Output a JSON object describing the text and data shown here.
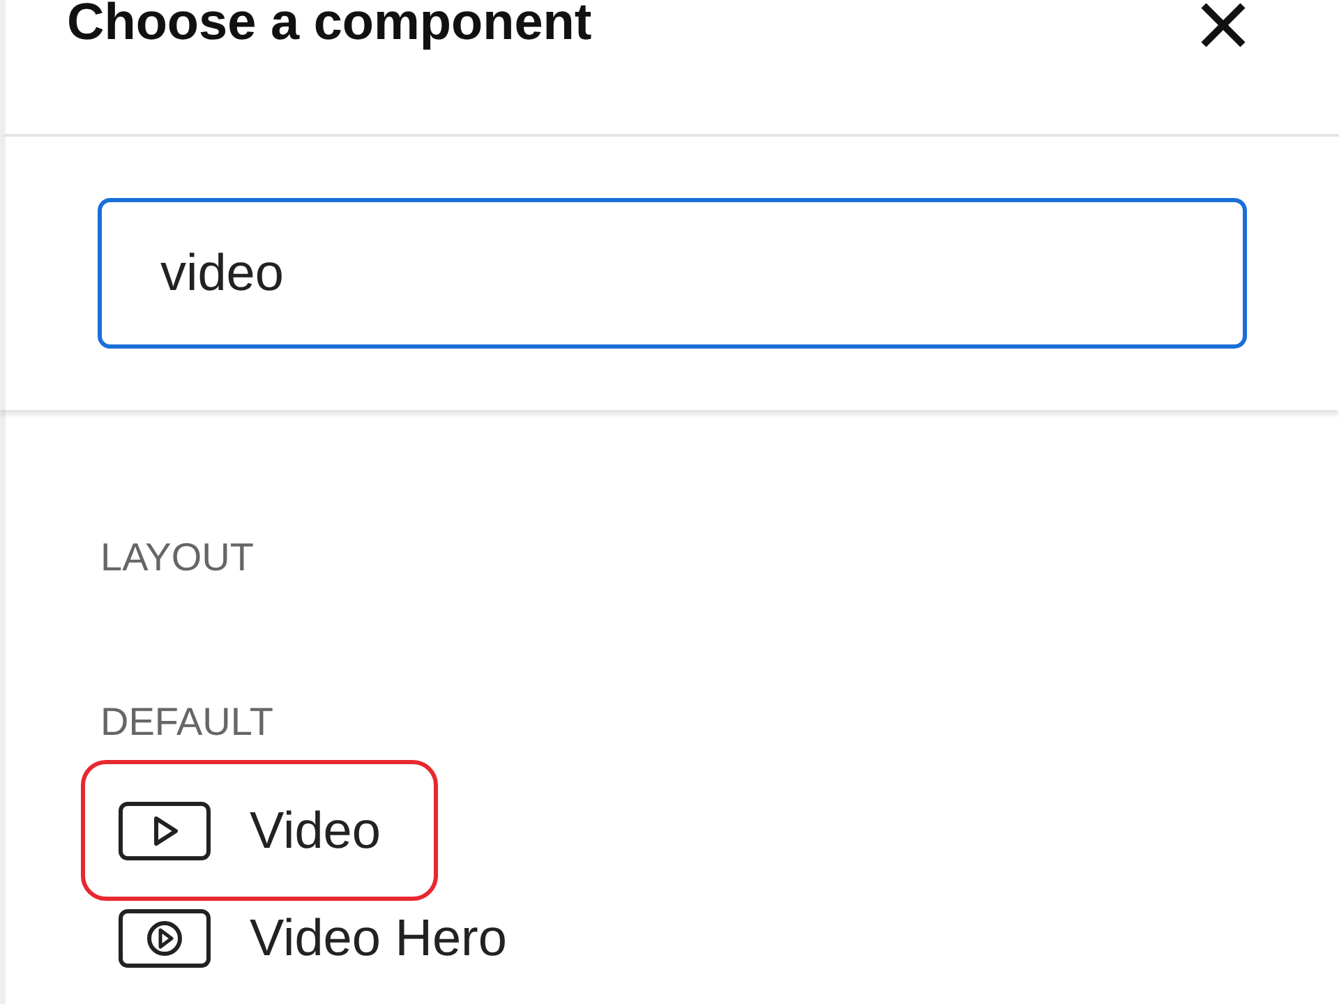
{
  "dialog": {
    "title": "Choose a component"
  },
  "search": {
    "value": "video"
  },
  "sections": [
    {
      "heading": "LAYOUT"
    },
    {
      "heading": "DEFAULT",
      "items": [
        {
          "label": "Video",
          "highlighted": true
        },
        {
          "label": "Video Hero",
          "highlighted": false
        }
      ]
    }
  ]
}
